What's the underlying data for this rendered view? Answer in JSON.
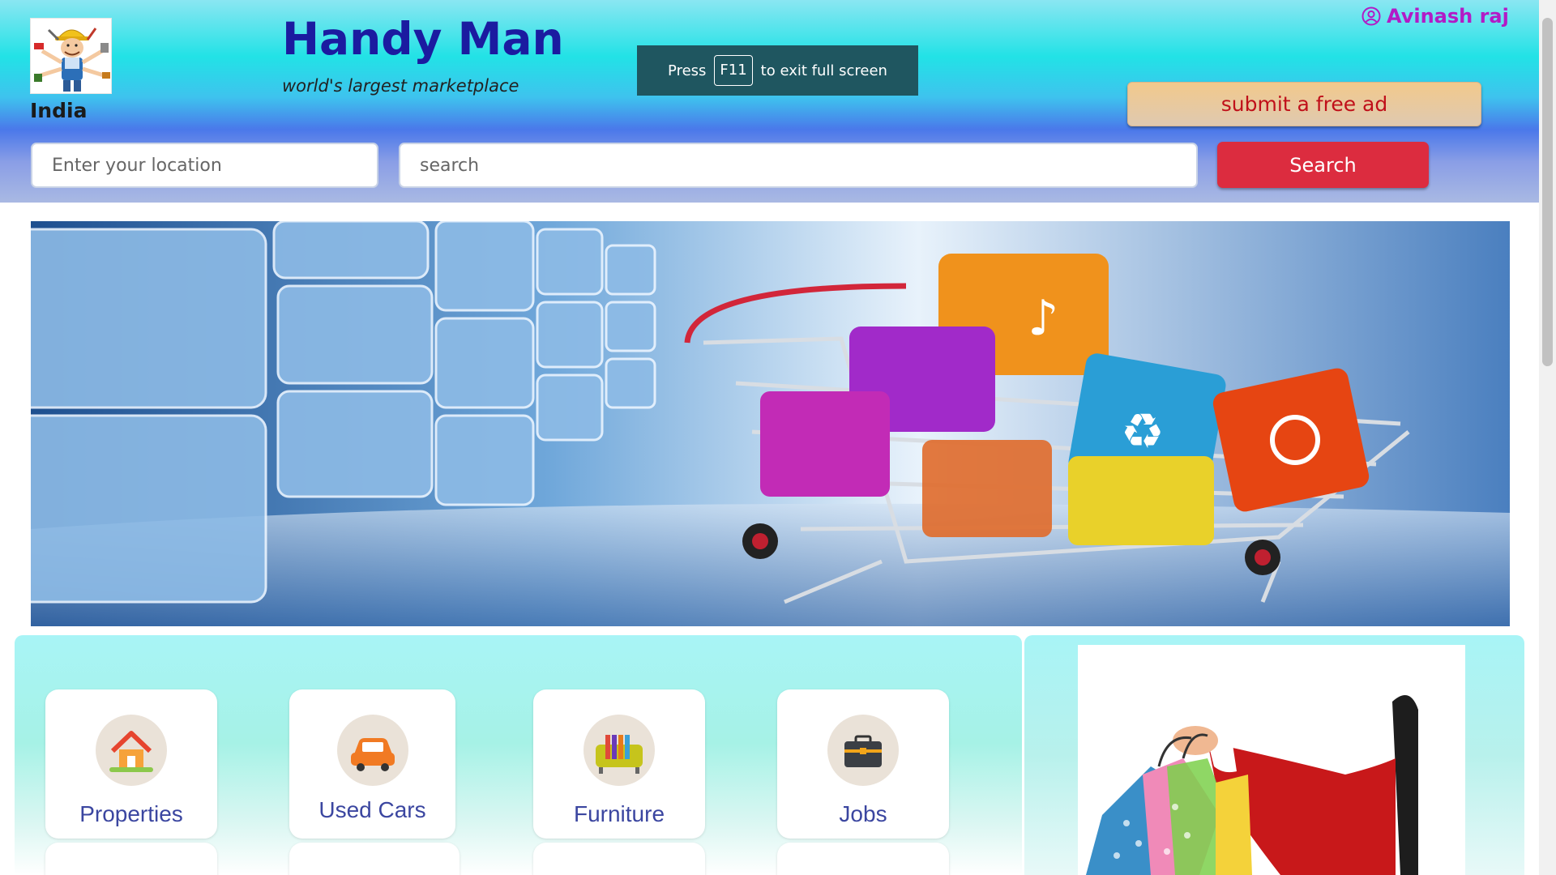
{
  "header": {
    "country": "India",
    "brand_title": "Handy Man",
    "brand_tagline": "world's largest marketplace",
    "user_name": "Avinash raj",
    "submit_ad_label": "submit a free ad"
  },
  "fullscreen_toast": {
    "press": "Press",
    "key": "F11",
    "suffix": "to exit full screen"
  },
  "search": {
    "location_placeholder": "Enter your location",
    "query_placeholder": "search",
    "button_label": "Search"
  },
  "categories": [
    {
      "label": "Properties",
      "icon": "house-icon"
    },
    {
      "label": "Used Cars",
      "icon": "car-icon"
    },
    {
      "label": "Furniture",
      "icon": "sofa-icon"
    },
    {
      "label": "Jobs",
      "icon": "briefcase-icon"
    }
  ],
  "colors": {
    "brand": "#1b1ba0",
    "user": "#b21bc6",
    "search_button": "#dc2c3f",
    "category_label": "#3b46a0"
  }
}
